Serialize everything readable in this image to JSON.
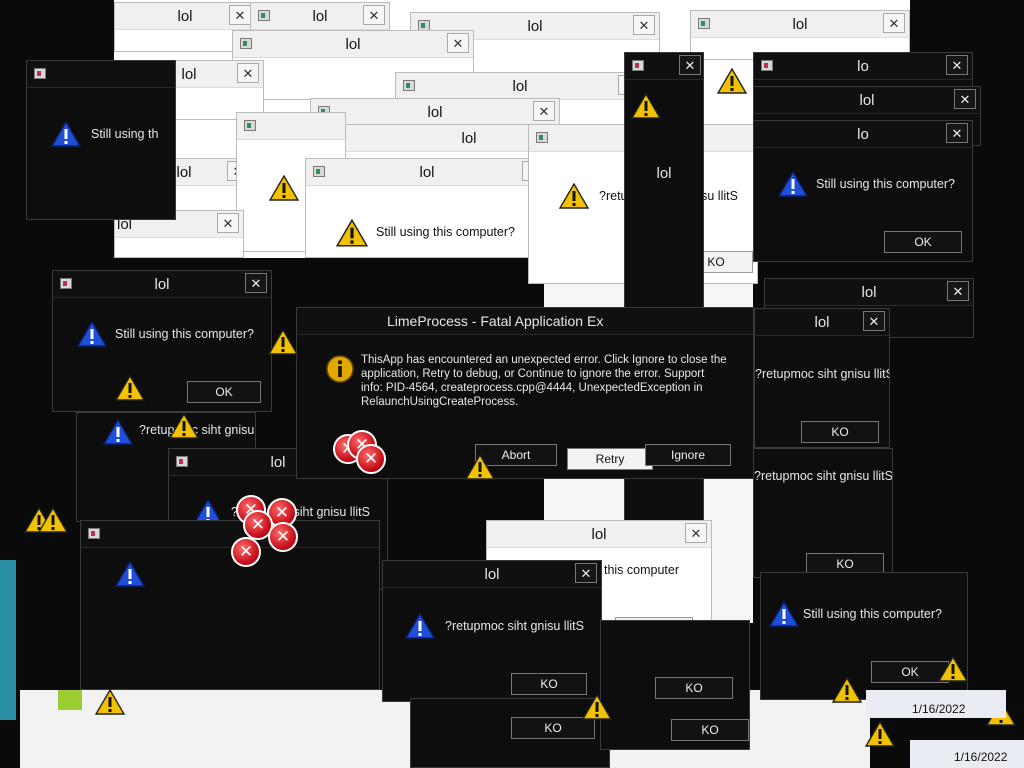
{
  "title_lol": "lol",
  "title_lo": "lo",
  "close_glyph": "✕",
  "prompt": "Still using this computer?",
  "prompt_cut": "Still using th",
  "prompt_cut2": "Still using this computer",
  "prompt_mirrored": "?retupmoc siht gnisu llitS",
  "prompt_mirrored_cut": "?retupmoc siht gnisu llitS",
  "ok": "OK",
  "ok_mirrored": "KO",
  "fatal": {
    "title": "LimeProcess - Fatal Application Ex",
    "body_line1": "ThisApp has encountered an unexpected error. Click Ignore to close the",
    "body_line2": "application, Retry to debug, or Continue to ignore the error. Support",
    "body_line3": "info: PID-4564, createprocess.cpp@4444, UnexpectedException in",
    "body_line4": "RelaunchUsingCreateProcess.",
    "abort": "Abort",
    "retry": "Retry",
    "ignore": "Ignore"
  },
  "taskbar": {
    "date1": "1/16/2022",
    "date2": "1/16/2022"
  },
  "colors": {
    "warning": "#f2c200",
    "question": "#1f4fd8",
    "error": "#d0101c"
  }
}
